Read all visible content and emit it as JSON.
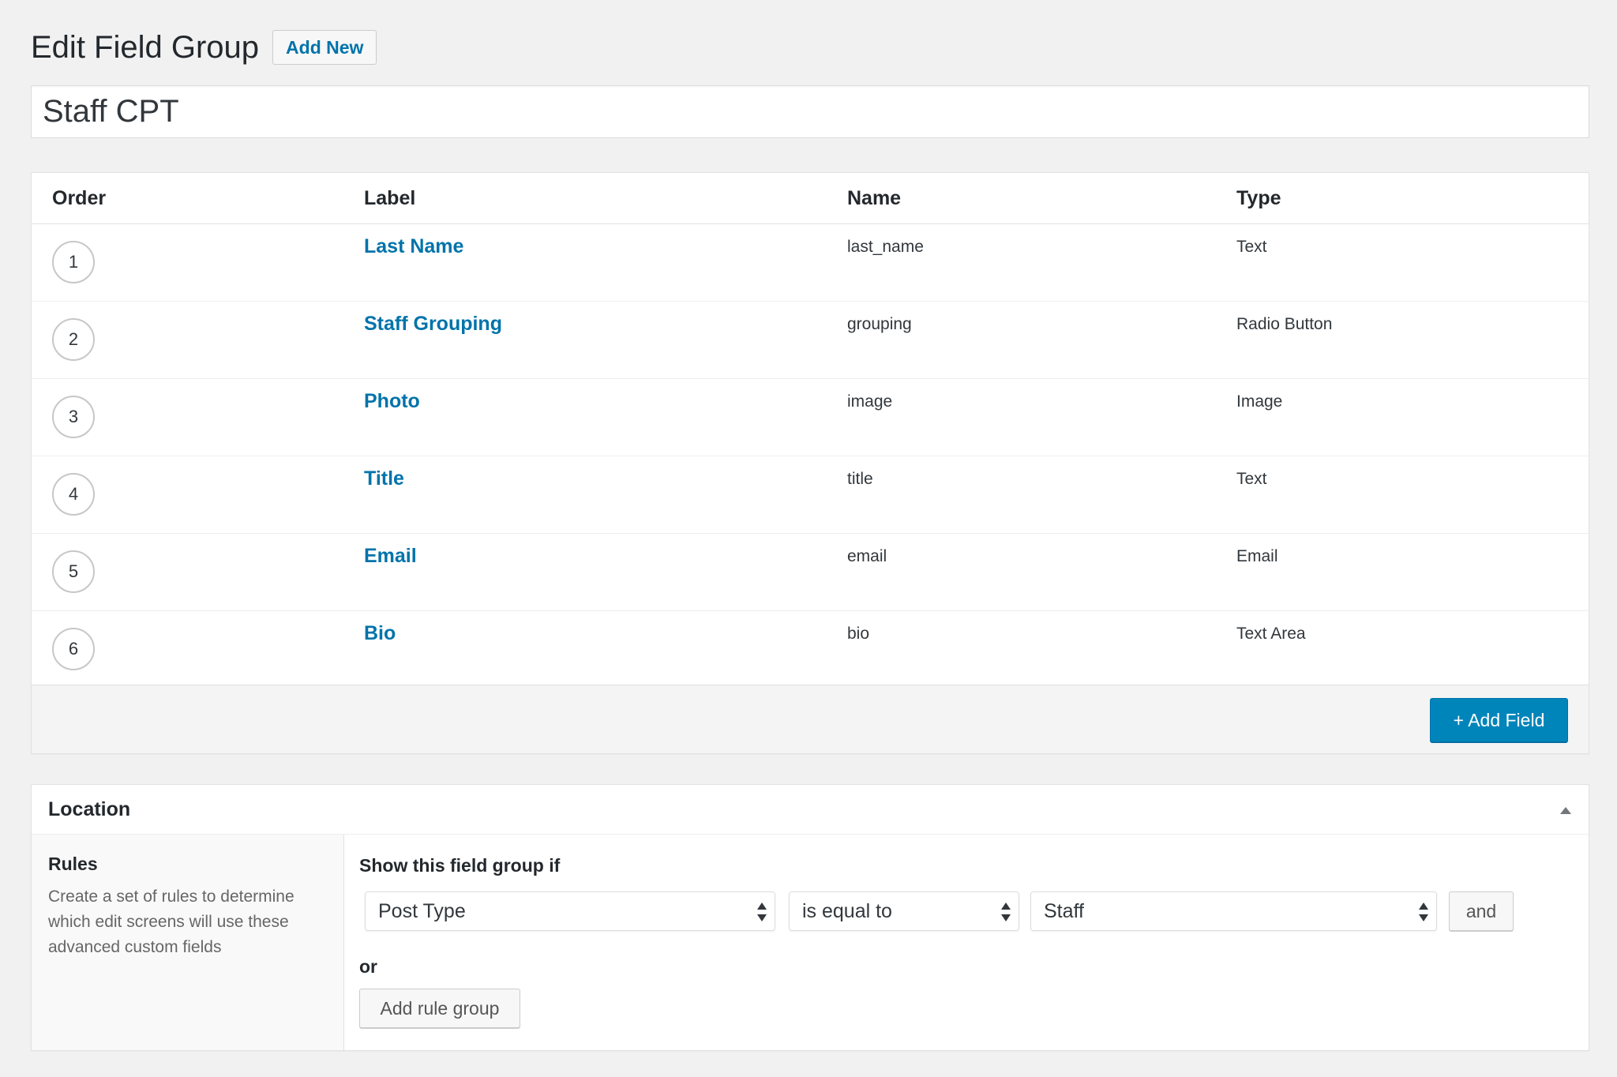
{
  "header": {
    "title": "Edit Field Group",
    "add_new_label": "Add New"
  },
  "group_title": "Staff CPT",
  "fields_table": {
    "columns": [
      "Order",
      "Label",
      "Name",
      "Type"
    ],
    "rows": [
      {
        "order": "1",
        "label": "Last Name",
        "name": "last_name",
        "type": "Text"
      },
      {
        "order": "2",
        "label": "Staff Grouping",
        "name": "grouping",
        "type": "Radio Button"
      },
      {
        "order": "3",
        "label": "Photo",
        "name": "image",
        "type": "Image"
      },
      {
        "order": "4",
        "label": "Title",
        "name": "title",
        "type": "Text"
      },
      {
        "order": "5",
        "label": "Email",
        "name": "email",
        "type": "Email"
      },
      {
        "order": "6",
        "label": "Bio",
        "name": "bio",
        "type": "Text Area"
      }
    ],
    "add_field_label": "+ Add Field"
  },
  "location": {
    "title": "Location",
    "rules_title": "Rules",
    "rules_description": "Create a set of rules to determine which edit screens will use these advanced custom fields",
    "show_if_label": "Show this field group if",
    "param_value": "Post Type",
    "operator_value": "is equal to",
    "value_value": "Staff",
    "and_label": "and",
    "or_label": "or",
    "add_rule_group_label": "Add rule group"
  },
  "colors": {
    "accent": "#0073aa",
    "primary_button": "#0085ba",
    "background": "#f1f1f1"
  },
  "icons": {
    "collapse": "triangle-up-icon",
    "select": "select-arrows-icon"
  }
}
